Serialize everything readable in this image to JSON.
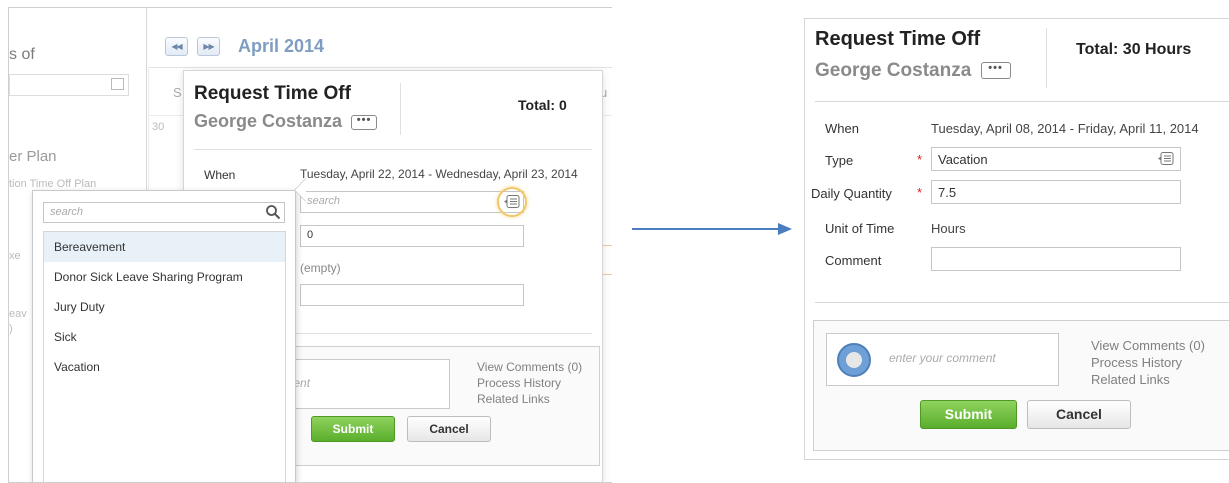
{
  "left": {
    "sidebar": {
      "title_fragment": "s of",
      "plan_fragment": "er Plan",
      "sub_fragment": "tion Time Off Plan",
      "frag_exe": "xe",
      "frag_eav": "eav",
      "frag_paren": ")"
    },
    "calendar": {
      "month": "April 2014",
      "prev_icon": "double-left-arrow-icon",
      "next_icon": "double-right-arrow-icon",
      "day_s": "S",
      "day_u": "u",
      "day_30": "30"
    },
    "popup": {
      "title": "Request Time Off",
      "employee": "George Costanza",
      "more_label": "•••",
      "total": "Total: 0",
      "when_label": "When",
      "when_value": "Tuesday, April 22, 2014 - Wednesday, April 23, 2014",
      "type_placeholder": "search",
      "quantity_value": "0",
      "unit_value": "(empty)",
      "comment_placeholder": "your comment",
      "links": [
        "View Comments (0)",
        "Process History",
        "Related Links"
      ],
      "submit_label": "Submit",
      "cancel_label": "Cancel"
    },
    "dropdown": {
      "search_placeholder": "search",
      "items": [
        "Bereavement",
        "Donor Sick Leave Sharing Program",
        "Jury Duty",
        "Sick",
        "Vacation"
      ],
      "selected_index": 0
    }
  },
  "right": {
    "title": "Request Time Off",
    "employee": "George Costanza",
    "more_label": "•••",
    "total": "Total: 30 Hours",
    "fields": {
      "when_label": "When",
      "when_value": "Tuesday, April 08, 2014 - Friday, April 11, 2014",
      "type_label": "Type",
      "type_value": "Vacation",
      "quantity_label": "Daily Quantity",
      "quantity_value": "7.5",
      "unit_label": "Unit of Time",
      "unit_value": "Hours",
      "comment_label": "Comment",
      "comment_value": ""
    },
    "comment_placeholder": "enter your comment",
    "links": [
      "View Comments (0)",
      "Process History",
      "Related Links"
    ],
    "submit_label": "Submit",
    "cancel_label": "Cancel"
  },
  "colors": {
    "month": "#7f9dc1",
    "submit": "#5aae2c",
    "required": "#e02020",
    "arrow": "#4a7dc0",
    "highlight_ring": "#f0c66a"
  }
}
